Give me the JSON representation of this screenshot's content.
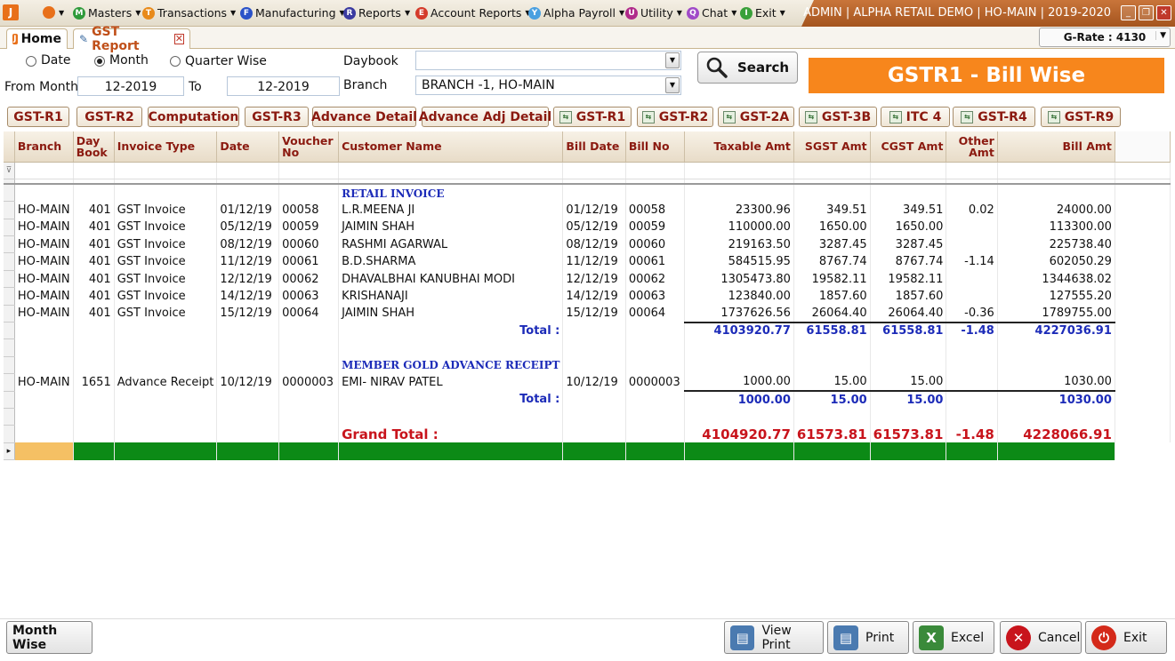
{
  "app": {
    "logo": "J",
    "menu": [
      {
        "label": "",
        "icon": "orange-circle-icon"
      },
      {
        "label": "Masters",
        "icon": "masters-icon",
        "color": "#2e9a3a",
        "glyph": "M"
      },
      {
        "label": "Transactions",
        "icon": "transactions-icon",
        "color": "#e88a1a",
        "glyph": "T"
      },
      {
        "label": "Manufacturing",
        "icon": "manufacturing-icon",
        "color": "#2a52c8",
        "glyph": "F"
      },
      {
        "label": "Reports",
        "icon": "reports-icon",
        "color": "#3a3aa0",
        "glyph": "R"
      },
      {
        "label": "Account Reports",
        "icon": "account-reports-icon",
        "color": "#d43a2a",
        "glyph": "E"
      },
      {
        "label": "Alpha Payroll",
        "icon": "payroll-icon",
        "color": "#4aa0e0",
        "glyph": "Y"
      },
      {
        "label": "Utility",
        "icon": "utility-icon",
        "color": "#b02a8a",
        "glyph": "U"
      },
      {
        "label": "Chat",
        "icon": "chat-icon",
        "color": "#a04ac8",
        "glyph": "Q"
      },
      {
        "label": "Exit",
        "icon": "exit-icon",
        "color": "#3aa03a",
        "glyph": "I"
      }
    ],
    "window_title": "ADMIN | ALPHA RETAIL DEMO | HO-MAIN | 2019-2020"
  },
  "tabs": {
    "home": "Home",
    "report": "GST Report",
    "grate": "G-Rate : 4130"
  },
  "filters": {
    "mode_options": [
      "Date",
      "Month",
      "Quarter Wise"
    ],
    "mode_selected": "Month",
    "from_month_label": "From Month",
    "from_month": "12-2019",
    "to_label": "To",
    "to_month": "12-2019",
    "daybook_label": "Daybook",
    "daybook_value": "",
    "branch_label": "Branch",
    "branch_value": "BRANCH -1, HO-MAIN",
    "search_label": "Search"
  },
  "banner": {
    "text": "GSTR1 - Bill Wise",
    "color": "#f7861c"
  },
  "report_buttons": [
    {
      "label": "GST-R1",
      "icon": false
    },
    {
      "label": "GST-R2",
      "icon": false
    },
    {
      "label": "Computation",
      "icon": false
    },
    {
      "label": "GST-R3",
      "icon": false
    },
    {
      "label": "Advance Detail",
      "icon": false
    },
    {
      "label": "Advance Adj Detail",
      "icon": false
    },
    {
      "label": "GST-R1",
      "icon": true
    },
    {
      "label": "GST-R2",
      "icon": true
    },
    {
      "label": "GST-2A",
      "icon": true
    },
    {
      "label": "GST-3B",
      "icon": true
    },
    {
      "label": "ITC 4",
      "icon": true
    },
    {
      "label": "GST-R4",
      "icon": true
    },
    {
      "label": "GST-R9",
      "icon": true
    }
  ],
  "grid": {
    "columns": [
      "Branch",
      "Day Book",
      "Invoice Type",
      "Date",
      "Voucher No",
      "Customer Name",
      "Bill Date",
      "Bill No",
      "Taxable Amt",
      "SGST Amt",
      "CGST Amt",
      "Other Amt",
      "Bill Amt"
    ],
    "sections": [
      {
        "title": "RETAIL INVOICE",
        "rows": [
          [
            "HO-MAIN",
            "401",
            "GST Invoice",
            "01/12/19",
            "00058",
            "L.R.MEENA JI",
            "01/12/19",
            "00058",
            "23300.96",
            "349.51",
            "349.51",
            "0.02",
            "24000.00"
          ],
          [
            "HO-MAIN",
            "401",
            "GST Invoice",
            "05/12/19",
            "00059",
            "JAIMIN SHAH",
            "05/12/19",
            "00059",
            "110000.00",
            "1650.00",
            "1650.00",
            "",
            "113300.00"
          ],
          [
            "HO-MAIN",
            "401",
            "GST Invoice",
            "08/12/19",
            "00060",
            "RASHMI AGARWAL",
            "08/12/19",
            "00060",
            "219163.50",
            "3287.45",
            "3287.45",
            "",
            "225738.40"
          ],
          [
            "HO-MAIN",
            "401",
            "GST Invoice",
            "11/12/19",
            "00061",
            "B.D.SHARMA",
            "11/12/19",
            "00061",
            "584515.95",
            "8767.74",
            "8767.74",
            "-1.14",
            "602050.29"
          ],
          [
            "HO-MAIN",
            "401",
            "GST Invoice",
            "12/12/19",
            "00062",
            "DHAVALBHAI KANUBHAI MODI",
            "12/12/19",
            "00062",
            "1305473.80",
            "19582.11",
            "19582.11",
            "",
            "1344638.02"
          ],
          [
            "HO-MAIN",
            "401",
            "GST Invoice",
            "14/12/19",
            "00063",
            "KRISHANAJI",
            "14/12/19",
            "00063",
            "123840.00",
            "1857.60",
            "1857.60",
            "",
            "127555.20"
          ],
          [
            "HO-MAIN",
            "401",
            "GST Invoice",
            "15/12/19",
            "00064",
            "JAIMIN SHAH",
            "15/12/19",
            "00064",
            "1737626.56",
            "26064.40",
            "26064.40",
            "-0.36",
            "1789755.00"
          ]
        ],
        "total_label": "Total :",
        "total": [
          "4103920.77",
          "61558.81",
          "61558.81",
          "-1.48",
          "4227036.91"
        ]
      },
      {
        "title": "MEMBER GOLD ADVANCE RECEIPT",
        "rows": [
          [
            "HO-MAIN",
            "1651",
            "Advance Receipt",
            "10/12/19",
            "0000003",
            "EMI- NIRAV PATEL",
            "10/12/19",
            "0000003",
            "1000.00",
            "15.00",
            "15.00",
            "",
            "1030.00"
          ]
        ],
        "total_label": "Total :",
        "total": [
          "1000.00",
          "15.00",
          "15.00",
          "",
          "1030.00"
        ]
      }
    ],
    "grand_label": "Grand Total :",
    "grand_total": [
      "4104920.77",
      "61573.81",
      "61573.81",
      "-1.48",
      "4228066.91"
    ]
  },
  "footer": {
    "month_wise": "Month Wise",
    "buttons": [
      {
        "label": "View Print",
        "icon": "view-print-icon"
      },
      {
        "label": "Print",
        "icon": "print-icon"
      },
      {
        "label": "Excel",
        "icon": "excel-icon"
      },
      {
        "label": "Cancel",
        "icon": "cancel-icon"
      },
      {
        "label": "Exit",
        "icon": "exit-power-icon"
      }
    ]
  }
}
